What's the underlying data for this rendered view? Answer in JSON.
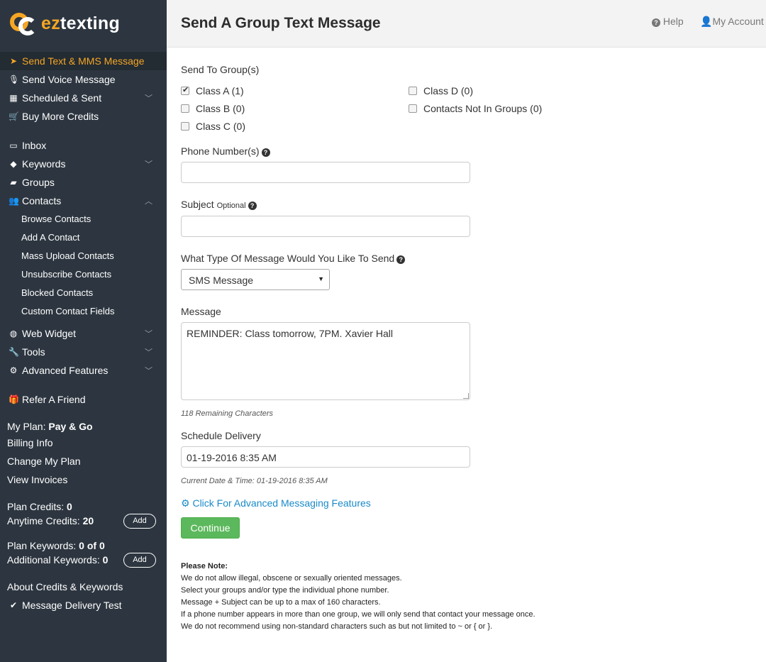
{
  "brand": {
    "prefix": "ez",
    "suffix": "texting"
  },
  "header": {
    "title": "Send A Group Text Message",
    "help": "Help",
    "account": "My Account"
  },
  "sidebar": {
    "nav": [
      {
        "label": "Send Text & MMS Message",
        "icon": "paper-plane-icon"
      },
      {
        "label": "Send Voice Message",
        "icon": "microphone-icon"
      },
      {
        "label": "Scheduled & Sent",
        "icon": "calendar-icon"
      },
      {
        "label": "Buy More Credits",
        "icon": "cart-icon"
      },
      {
        "label": "Inbox",
        "icon": "inbox-icon"
      },
      {
        "label": "Keywords",
        "icon": "tags-icon"
      },
      {
        "label": "Groups",
        "icon": "folder-icon"
      },
      {
        "label": "Contacts",
        "icon": "users-icon"
      },
      {
        "label": "Web Widget",
        "icon": "globe-icon"
      },
      {
        "label": "Tools",
        "icon": "wrench-icon"
      },
      {
        "label": "Advanced Features",
        "icon": "cogs-icon"
      },
      {
        "label": "Refer A Friend",
        "icon": "gift-icon"
      }
    ],
    "contacts_sub": [
      "Browse Contacts",
      "Add A Contact",
      "Mass Upload Contacts",
      "Unsubscribe Contacts",
      "Blocked Contacts",
      "Custom Contact Fields"
    ],
    "plan_label": "My Plan:",
    "plan_value": "Pay & Go",
    "billing": "Billing Info",
    "change_plan": "Change My Plan",
    "invoices": "View Invoices",
    "plan_credits_label": "Plan Credits:",
    "plan_credits_value": "0",
    "anytime_credits_label": "Anytime Credits:",
    "anytime_credits_value": "20",
    "add_label": "Add",
    "plan_keywords_label": "Plan Keywords:",
    "plan_keywords_value": "0 of 0",
    "additional_keywords_label": "Additional Keywords:",
    "additional_keywords_value": "0",
    "about": "About Credits & Keywords",
    "delivery_test": "Message Delivery Test"
  },
  "form": {
    "groups_label": "Send To Group(s)",
    "groups": [
      {
        "label": "Class A (1)",
        "checked": true
      },
      {
        "label": "Class B (0)",
        "checked": false
      },
      {
        "label": "Class C (0)",
        "checked": false
      },
      {
        "label": "Class D (0)",
        "checked": false
      },
      {
        "label": "Contacts Not In Groups (0)",
        "checked": false
      }
    ],
    "phone_label": "Phone Number(s)",
    "phone_value": "",
    "subject_label": "Subject",
    "subject_optional": "Optional",
    "subject_value": "",
    "type_label": "What Type Of Message Would You Like To Send",
    "type_value": "SMS Message",
    "message_label": "Message",
    "message_value": "REMINDER: Class tomorrow, 7PM. Xavier Hall",
    "remaining": "118 Remaining Characters",
    "schedule_label": "Schedule Delivery",
    "schedule_value": "01-19-2016 8:35 AM",
    "current_time": "Current Date & Time: 01-19-2016 8:35 AM",
    "advanced_link": "Click For Advanced Messaging Features",
    "continue": "Continue"
  },
  "note": {
    "title": "Please Note:",
    "lines": [
      "We do not allow illegal, obscene or sexually oriented messages.",
      "Select your groups and/or type the individual phone number.",
      "Message + Subject can be up to a max of 160 characters.",
      "If a phone number appears in more than one group, we will only send that contact your message once.",
      "We do not recommend using non-standard characters such as but not limited to ~ or { or }."
    ]
  },
  "colors": {
    "sidebar_bg": "#2d3640",
    "accent": "#f5a623",
    "link": "#1a8ac8",
    "button": "#5cb85c"
  }
}
